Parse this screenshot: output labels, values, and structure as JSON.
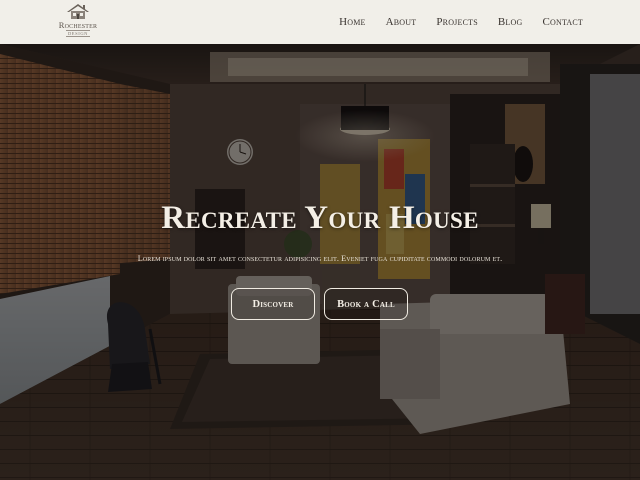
{
  "brand": {
    "name": "Rochester",
    "tagline": "DESIGN"
  },
  "nav": {
    "items": [
      "Home",
      "About",
      "Projects",
      "Blog",
      "Contact"
    ]
  },
  "hero": {
    "title": "Recreate Your House",
    "subtitle": "Lorem ipsum dolor sit amet consectetur adipisicing elit. Eveniet fuga cupiditate commodi dolorum et.",
    "primary_button": "Discover",
    "secondary_button": "Book a Call"
  }
}
